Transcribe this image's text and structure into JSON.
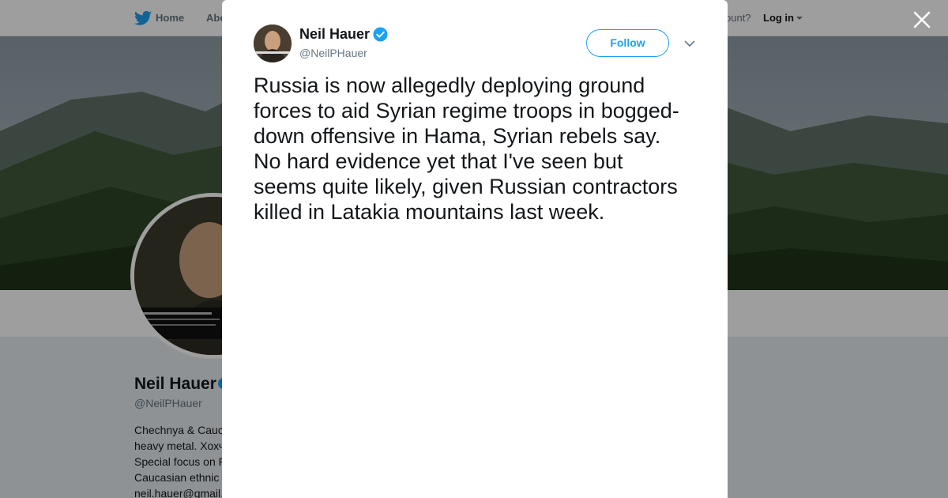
{
  "nav": {
    "home_label": "Home",
    "about_label": "Abo",
    "account_prompt": "ccount?",
    "login_label": "Log in"
  },
  "profile": {
    "name": "Neil Hauer",
    "handle": "@NeilPHauer",
    "bio_lines": [
      "Chechnya & Cauc",
      "heavy metal. Хохч",
      "Special focus on R",
      "Caucasian ethnic",
      "neil.hauer@gmail."
    ]
  },
  "tweet": {
    "author_name": "Neil Hauer",
    "author_handle": "@NeilPHauer",
    "verified": true,
    "follow_label": "Follow",
    "text_lines": [
      "Russia is now allegedly deploying ground",
      "forces to aid Syrian regime troops in bogged-",
      "down offensive in Hama, Syrian rebels say.",
      "No hard evidence yet that I've seen but",
      "seems quite likely, given Russian contractors",
      "killed in Latakia mountains last week."
    ]
  },
  "icons": {
    "logo": "twitter-bird-icon",
    "verified": "verified-badge-icon",
    "menu": "chevron-down-icon",
    "close": "close-icon"
  },
  "colors": {
    "brand_blue": "#1da1f2",
    "text_primary": "#14171a",
    "text_secondary": "#657786",
    "overlay": "rgba(0,0,0,0.38)"
  }
}
